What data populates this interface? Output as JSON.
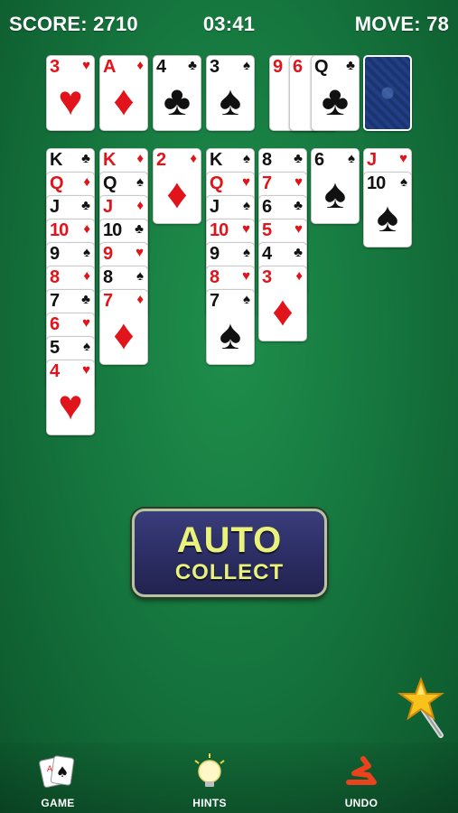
{
  "hud": {
    "score": "SCORE: 2710",
    "time": "03:41",
    "move": "MOVE: 78"
  },
  "colors": {
    "red": "#e0141a",
    "black": "#111111",
    "felt": "#16783f",
    "button_text": "#e9f27a"
  },
  "foundations": [
    {
      "rank": "3",
      "suit": "♥",
      "color": "red"
    },
    {
      "rank": "A",
      "suit": "♦",
      "color": "red"
    },
    {
      "rank": "4",
      "suit": "♣",
      "color": "black"
    },
    {
      "rank": "3",
      "suit": "♠",
      "color": "black"
    }
  ],
  "waste": [
    {
      "rank": "9",
      "suit": "♦",
      "color": "red"
    },
    {
      "rank": "6",
      "suit": "♦",
      "color": "red"
    },
    {
      "rank": "Q",
      "suit": "♣",
      "color": "black"
    }
  ],
  "stock": {
    "face_down": true
  },
  "tableau": [
    [
      {
        "rank": "K",
        "suit": "♣",
        "color": "black"
      },
      {
        "rank": "Q",
        "suit": "♦",
        "color": "red"
      },
      {
        "rank": "J",
        "suit": "♣",
        "color": "black"
      },
      {
        "rank": "10",
        "suit": "♦",
        "color": "red"
      },
      {
        "rank": "9",
        "suit": "♠",
        "color": "black"
      },
      {
        "rank": "8",
        "suit": "♦",
        "color": "red"
      },
      {
        "rank": "7",
        "suit": "♣",
        "color": "black"
      },
      {
        "rank": "6",
        "suit": "♥",
        "color": "red"
      },
      {
        "rank": "5",
        "suit": "♠",
        "color": "black"
      },
      {
        "rank": "4",
        "suit": "♥",
        "color": "red"
      }
    ],
    [
      {
        "rank": "K",
        "suit": "♦",
        "color": "red"
      },
      {
        "rank": "Q",
        "suit": "♠",
        "color": "black"
      },
      {
        "rank": "J",
        "suit": "♦",
        "color": "red"
      },
      {
        "rank": "10",
        "suit": "♣",
        "color": "black"
      },
      {
        "rank": "9",
        "suit": "♥",
        "color": "red"
      },
      {
        "rank": "8",
        "suit": "♠",
        "color": "black"
      },
      {
        "rank": "7",
        "suit": "♦",
        "color": "red"
      }
    ],
    [
      {
        "rank": "2",
        "suit": "♦",
        "color": "red"
      }
    ],
    [
      {
        "rank": "K",
        "suit": "♠",
        "color": "black"
      },
      {
        "rank": "Q",
        "suit": "♥",
        "color": "red"
      },
      {
        "rank": "J",
        "suit": "♠",
        "color": "black"
      },
      {
        "rank": "10",
        "suit": "♥",
        "color": "red"
      },
      {
        "rank": "9",
        "suit": "♠",
        "color": "black"
      },
      {
        "rank": "8",
        "suit": "♥",
        "color": "red"
      },
      {
        "rank": "7",
        "suit": "♠",
        "color": "black"
      }
    ],
    [
      {
        "rank": "8",
        "suit": "♣",
        "color": "black"
      },
      {
        "rank": "7",
        "suit": "♥",
        "color": "red"
      },
      {
        "rank": "6",
        "suit": "♣",
        "color": "black"
      },
      {
        "rank": "5",
        "suit": "♥",
        "color": "red"
      },
      {
        "rank": "4",
        "suit": "♣",
        "color": "black"
      },
      {
        "rank": "3",
        "suit": "♦",
        "color": "red"
      }
    ],
    [
      {
        "rank": "6",
        "suit": "♠",
        "color": "black"
      }
    ],
    [
      {
        "rank": "J",
        "suit": "♥",
        "color": "red"
      },
      {
        "rank": "10",
        "suit": "♠",
        "color": "black"
      }
    ]
  ],
  "auto_collect": {
    "line1": "AUTO",
    "line2": "COLLECT"
  },
  "toolbar": {
    "game": {
      "label": "GAME",
      "icon": "cards-icon"
    },
    "hints": {
      "label": "HINTS",
      "icon": "lightbulb-icon"
    },
    "undo": {
      "label": "UNDO",
      "icon": "undo-arrow-icon"
    }
  },
  "magic_wand": {
    "icon": "magic-wand-star-icon"
  }
}
